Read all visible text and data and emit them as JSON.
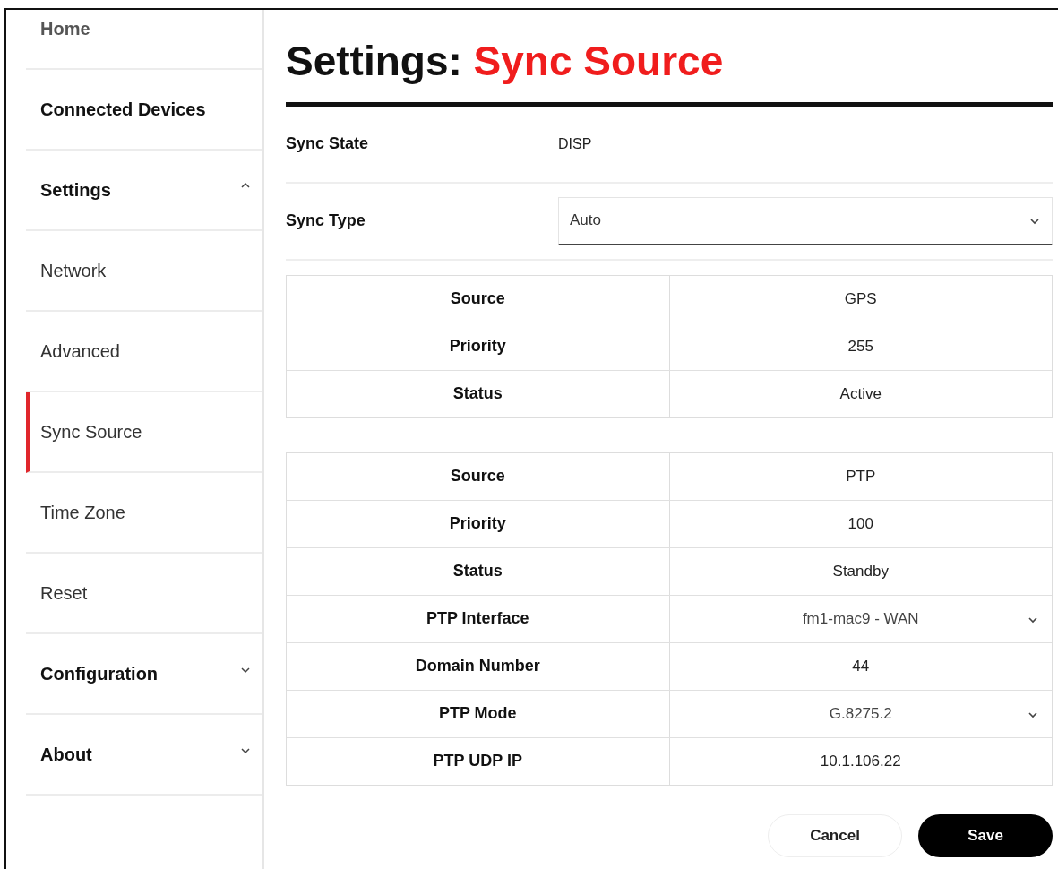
{
  "sidebar": {
    "items": [
      {
        "label": "Home",
        "kind": "plain",
        "selected": false
      },
      {
        "label": "Connected Devices",
        "kind": "section",
        "selected": false
      },
      {
        "label": "Settings",
        "kind": "section",
        "selected": false,
        "expanded": true,
        "children": [
          {
            "label": "Network",
            "selected": false
          },
          {
            "label": "Advanced",
            "selected": false
          },
          {
            "label": "Sync Source",
            "selected": true
          },
          {
            "label": "Time Zone",
            "selected": false
          },
          {
            "label": "Reset",
            "selected": false
          }
        ]
      },
      {
        "label": "Configuration",
        "kind": "section",
        "selected": false,
        "expanded": false
      },
      {
        "label": "About",
        "kind": "section",
        "selected": false,
        "expanded": false
      }
    ]
  },
  "page": {
    "title": "Settings:",
    "title_accent": "Sync Source"
  },
  "fields": [
    {
      "label": "Sync State",
      "kind": "text",
      "value": "DISP"
    },
    {
      "label": "Sync Type",
      "kind": "select",
      "value": "Auto"
    }
  ],
  "tables": [
    {
      "rows": [
        {
          "label": "Source",
          "kind": "text",
          "value": "GPS"
        },
        {
          "label": "Priority",
          "kind": "text",
          "value": "255"
        },
        {
          "label": "Status",
          "kind": "text",
          "value": "Active"
        }
      ]
    },
    {
      "rows": [
        {
          "label": "Source",
          "kind": "text",
          "value": "PTP"
        },
        {
          "label": "Priority",
          "kind": "text",
          "value": "100"
        },
        {
          "label": "Status",
          "kind": "text",
          "value": "Standby"
        },
        {
          "label": "PTP Interface",
          "kind": "select",
          "value": "fm1-mac9 - WAN"
        },
        {
          "label": "Domain Number",
          "kind": "text",
          "value": "44"
        },
        {
          "label": "PTP Mode",
          "kind": "select",
          "value": "G.8275.2"
        },
        {
          "label": "PTP UDP IP",
          "kind": "text",
          "value": "10.1.106.22"
        }
      ]
    }
  ],
  "buttons": [
    {
      "label": "Cancel",
      "kind": "secondary"
    },
    {
      "label": "Save",
      "kind": "primary"
    }
  ]
}
